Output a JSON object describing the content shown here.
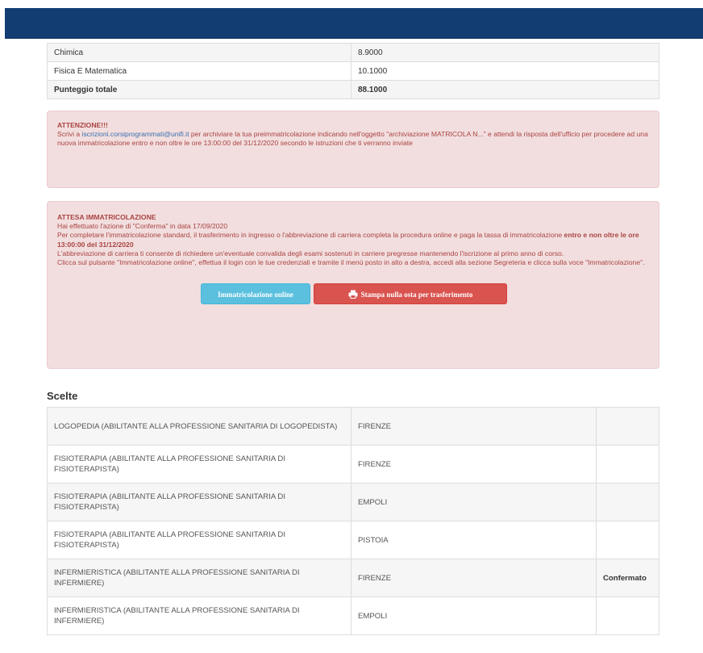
{
  "scores": [
    {
      "subject": "Chimica",
      "value": "8.9000"
    },
    {
      "subject": "Fisica E Matematica",
      "value": "10.1000"
    },
    {
      "subject": "Punteggio totale",
      "value": "88.1000"
    }
  ],
  "alert_attenzione": {
    "title": "ATTENZIONE!!!",
    "line_pre": "Scrivi a ",
    "email": "iscrizioni.corsiprogrammati@unifi.it",
    "line_post": " per archiviare la tua preimmatricolazione indicando nell'oggetto \"archiviazione MATRICOLA N...\" e attendi la risposta dell'ufficio per procedere ad una nuova immatricolazione entro e non oltre le ore 13:00:00 del 31/12/2020 secondo le istruzioni che ti verranno inviate"
  },
  "alert_attesa": {
    "title": "ATTESA IMMATRICOLAZIONE",
    "p1": "Hai effettuato l'azione di \"Conferma\" in data 17/09/2020",
    "p2_pre": "Per completare l'immatricolazione standard, il trasferimento in ingresso o l'abbreviazione di carriera completa la procedura online e paga la tassa di immatricolazione ",
    "p2_bold": "entro e non oltre le ore 13:00:00 del 31/12/2020",
    "p3": "L'abbreviazione di carriera ti consente di richiedere un'eventuale convalida degli esami sostenuti in carriere pregresse mantenendo l'iscrizione al primo anno di corso.",
    "p4": "Clicca sul pulsante \"Immatricolazione online\", effettua il login con le tue credenziali e tramite il menù posto in alto a destra, accedi alla sezione Segreteria e clicca sulla voce \"Immatricolazione\".",
    "btn_online": "Immatricolazione online",
    "btn_print": "Stampa nulla osta per trasferimento"
  },
  "choices_title": "Scelte",
  "choices": [
    {
      "course": "LOGOPEDIA (ABILITANTE ALLA PROFESSIONE SANITARIA DI LOGOPEDISTA)",
      "site": "FIRENZE",
      "status": ""
    },
    {
      "course": "FISIOTERAPIA (ABILITANTE ALLA PROFESSIONE SANITARIA DI FISIOTERAPISTA)",
      "site": "FIRENZE",
      "status": ""
    },
    {
      "course": "FISIOTERAPIA (ABILITANTE ALLA PROFESSIONE SANITARIA DI FISIOTERAPISTA)",
      "site": "EMPOLI",
      "status": ""
    },
    {
      "course": "FISIOTERAPIA (ABILITANTE ALLA PROFESSIONE SANITARIA DI FISIOTERAPISTA)",
      "site": "PISTOIA",
      "status": ""
    },
    {
      "course": "INFERMIERISTICA (ABILITANTE ALLA PROFESSIONE SANITARIA DI INFERMIERE)",
      "site": "FIRENZE",
      "status": "Confermato"
    },
    {
      "course": "INFERMIERISTICA (ABILITANTE ALLA PROFESSIONE SANITARIA DI INFERMIERE)",
      "site": "EMPOLI",
      "status": ""
    }
  ],
  "colors": {
    "header": "#113d73",
    "alert_bg": "#f2dede",
    "alert_text": "#a94442",
    "btn_info": "#5bc0de",
    "btn_danger": "#d9534f"
  },
  "icons": {
    "print": "printer-icon"
  }
}
